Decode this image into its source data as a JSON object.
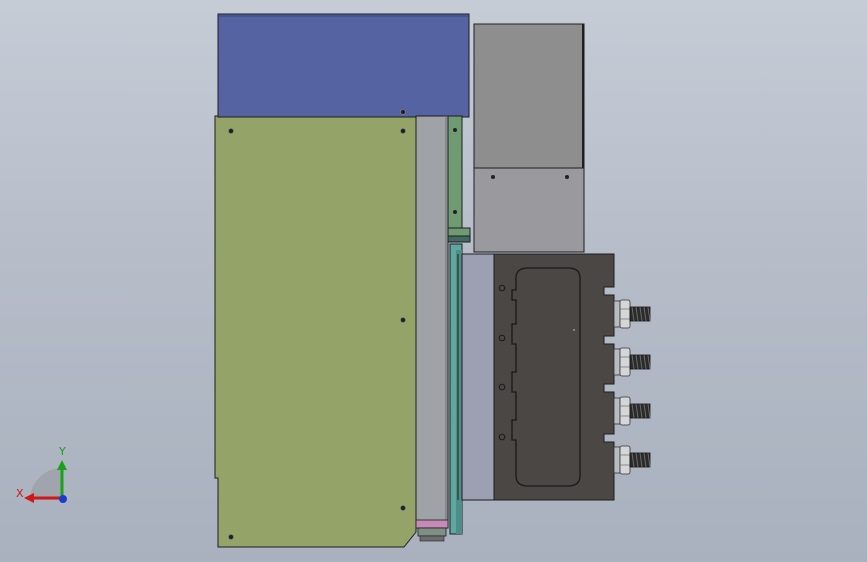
{
  "viewport": {
    "background_top": "#c6ccd6",
    "background_bottom": "#a9b1be"
  },
  "colors": {
    "top_block": "#5663a3",
    "main_panel": "#94a468",
    "rail_gray": "#9fa2a6",
    "green_bar": "#6f9a72",
    "teal_plate": "#5fa8a0",
    "upper_block_top": "#8e8e8e",
    "upper_block_bottom": "#9a9a9e",
    "lavender_plate": "#9da0b2",
    "dark_housing": "#4a4745",
    "pink_strip": "#c58ab5",
    "outline": "#1e1e1e"
  },
  "triad": {
    "x_label": "X",
    "y_label": "Y",
    "x_color": "#d01818",
    "y_color": "#1aa11a",
    "z_color": "#1a3ad0"
  }
}
